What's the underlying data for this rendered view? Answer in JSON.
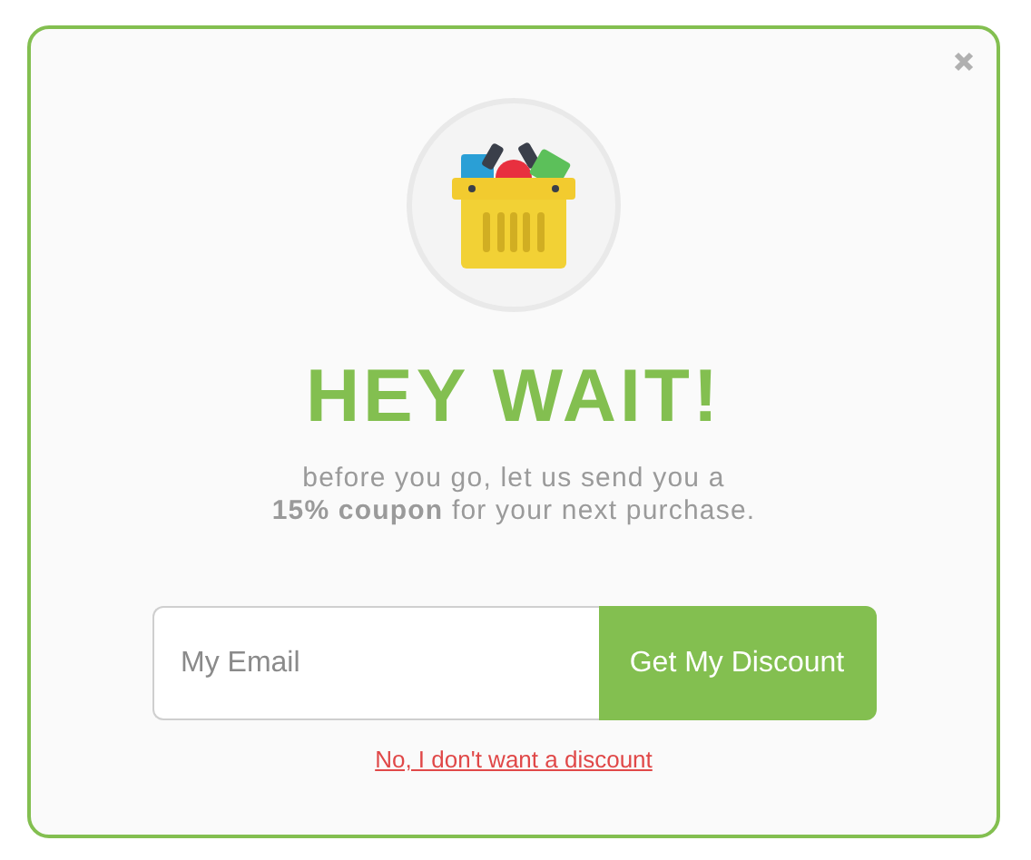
{
  "title": "HEY WAIT!",
  "message": "before you go, let us send you a\n**15% coupon** for your next purchase.",
  "email_field": {
    "placeholder": "My Email"
  },
  "submit_button": "Get My Discount",
  "decline_link": "No, I don't want a discount"
}
